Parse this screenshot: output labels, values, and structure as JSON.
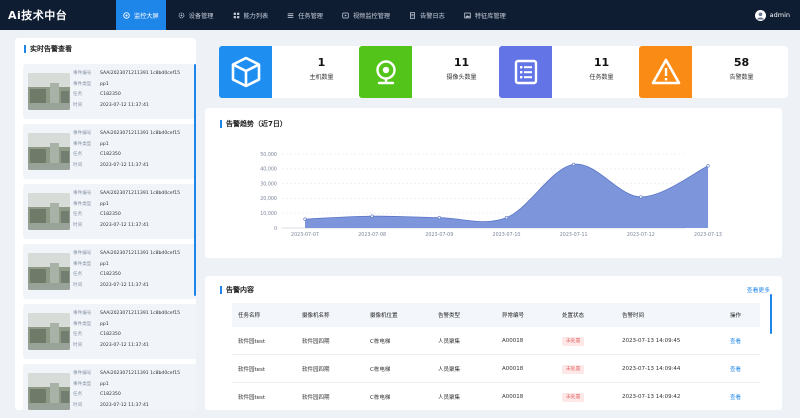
{
  "app": {
    "title": "Ai技术中台",
    "user": "admin"
  },
  "nav": [
    {
      "label": "监控大屏",
      "icon": "monitor-icon",
      "active": true
    },
    {
      "label": "设备管理",
      "icon": "gear-icon"
    },
    {
      "label": "能力列表",
      "icon": "grid-icon"
    },
    {
      "label": "任务管理",
      "icon": "list-icon"
    },
    {
      "label": "视频监控管理",
      "icon": "video-icon"
    },
    {
      "label": "告警日志",
      "icon": "document-icon"
    },
    {
      "label": "特征库管理",
      "icon": "image-icon"
    }
  ],
  "realtime": {
    "title": "实时告警查看",
    "labels": {
      "event": "事件编号",
      "type": "事件类型",
      "task": "任务",
      "time": "时间"
    },
    "items": [
      {
        "event": "SAAi2023071211391 1c8bd0cef15",
        "type": "pp1",
        "task": "C182350",
        "time": "2023-07-12 11:37:41"
      },
      {
        "event": "SAAi2023071211391 1c8bd0cef15",
        "type": "pp1",
        "task": "C182350",
        "time": "2023-07-12 11:37:41"
      },
      {
        "event": "SAAi2023071211391 1c8bd0cef15",
        "type": "pp1",
        "task": "C182350",
        "time": "2023-07-12 11:37:41"
      },
      {
        "event": "SAAi2023071211391 1c8bd0cef15",
        "type": "pp1",
        "task": "C182350",
        "time": "2023-07-12 11:37:41"
      },
      {
        "event": "SAAi2023071211391 1c8bd0cef15",
        "type": "pp1",
        "task": "C182350",
        "time": "2023-07-12 11:37:41"
      },
      {
        "event": "SAAi2023071211391 1c8bd0cef15",
        "type": "pp1",
        "task": "C182350",
        "time": "2023-07-12 11:37:41"
      }
    ]
  },
  "stats": [
    {
      "value": "1",
      "label": "主机数量",
      "color": "#1f8ef1",
      "icon": "box-icon"
    },
    {
      "value": "11",
      "label": "摄像头数量",
      "color": "#52c41a",
      "icon": "camera-icon"
    },
    {
      "value": "11",
      "label": "任务数量",
      "color": "#6274e6",
      "icon": "task-list-icon"
    },
    {
      "value": "58",
      "label": "告警数量",
      "color": "#fa8c16",
      "icon": "warning-icon"
    }
  ],
  "trend": {
    "title": "告警趋势（近7日）"
  },
  "chart_data": {
    "type": "area",
    "title": "告警趋势（近7日）",
    "categories": [
      "2023-07-07",
      "2023-07-08",
      "2023-07-09",
      "2023-07-10",
      "2023-07-11",
      "2023-07-12",
      "2023-07-13"
    ],
    "values": [
      6000,
      8000,
      7000,
      7000,
      43000,
      21000,
      42000
    ],
    "ylim": [
      0,
      50000
    ],
    "yticks": [
      "0",
      "10,000",
      "20,000",
      "30,000",
      "40,000",
      "50,000"
    ],
    "color": "#6f8ad6",
    "grid": true
  },
  "alerts": {
    "title": "告警内容",
    "more": "查看更多",
    "columns": [
      "任务名称",
      "摄像机名称",
      "摄像机位置",
      "告警类型",
      "异常编号",
      "处置状态",
      "告警时间",
      "操作"
    ],
    "rows": [
      {
        "task": "软件园test",
        "camera": "软件园四期",
        "location": "C栋电梯",
        "type": "人员聚集",
        "code": "A00018",
        "status": "未处置",
        "time": "2023-07-13 14:09:45",
        "action": "查看"
      },
      {
        "task": "软件园test",
        "camera": "软件园四期",
        "location": "C栋电梯",
        "type": "人员聚集",
        "code": "A00018",
        "status": "未处置",
        "time": "2023-07-13 14:09:44",
        "action": "查看"
      },
      {
        "task": "软件园test",
        "camera": "软件园四期",
        "location": "C栋电梯",
        "type": "人员聚集",
        "code": "A00018",
        "status": "未处置",
        "time": "2023-07-13 14:09:42",
        "action": "查看"
      }
    ]
  }
}
